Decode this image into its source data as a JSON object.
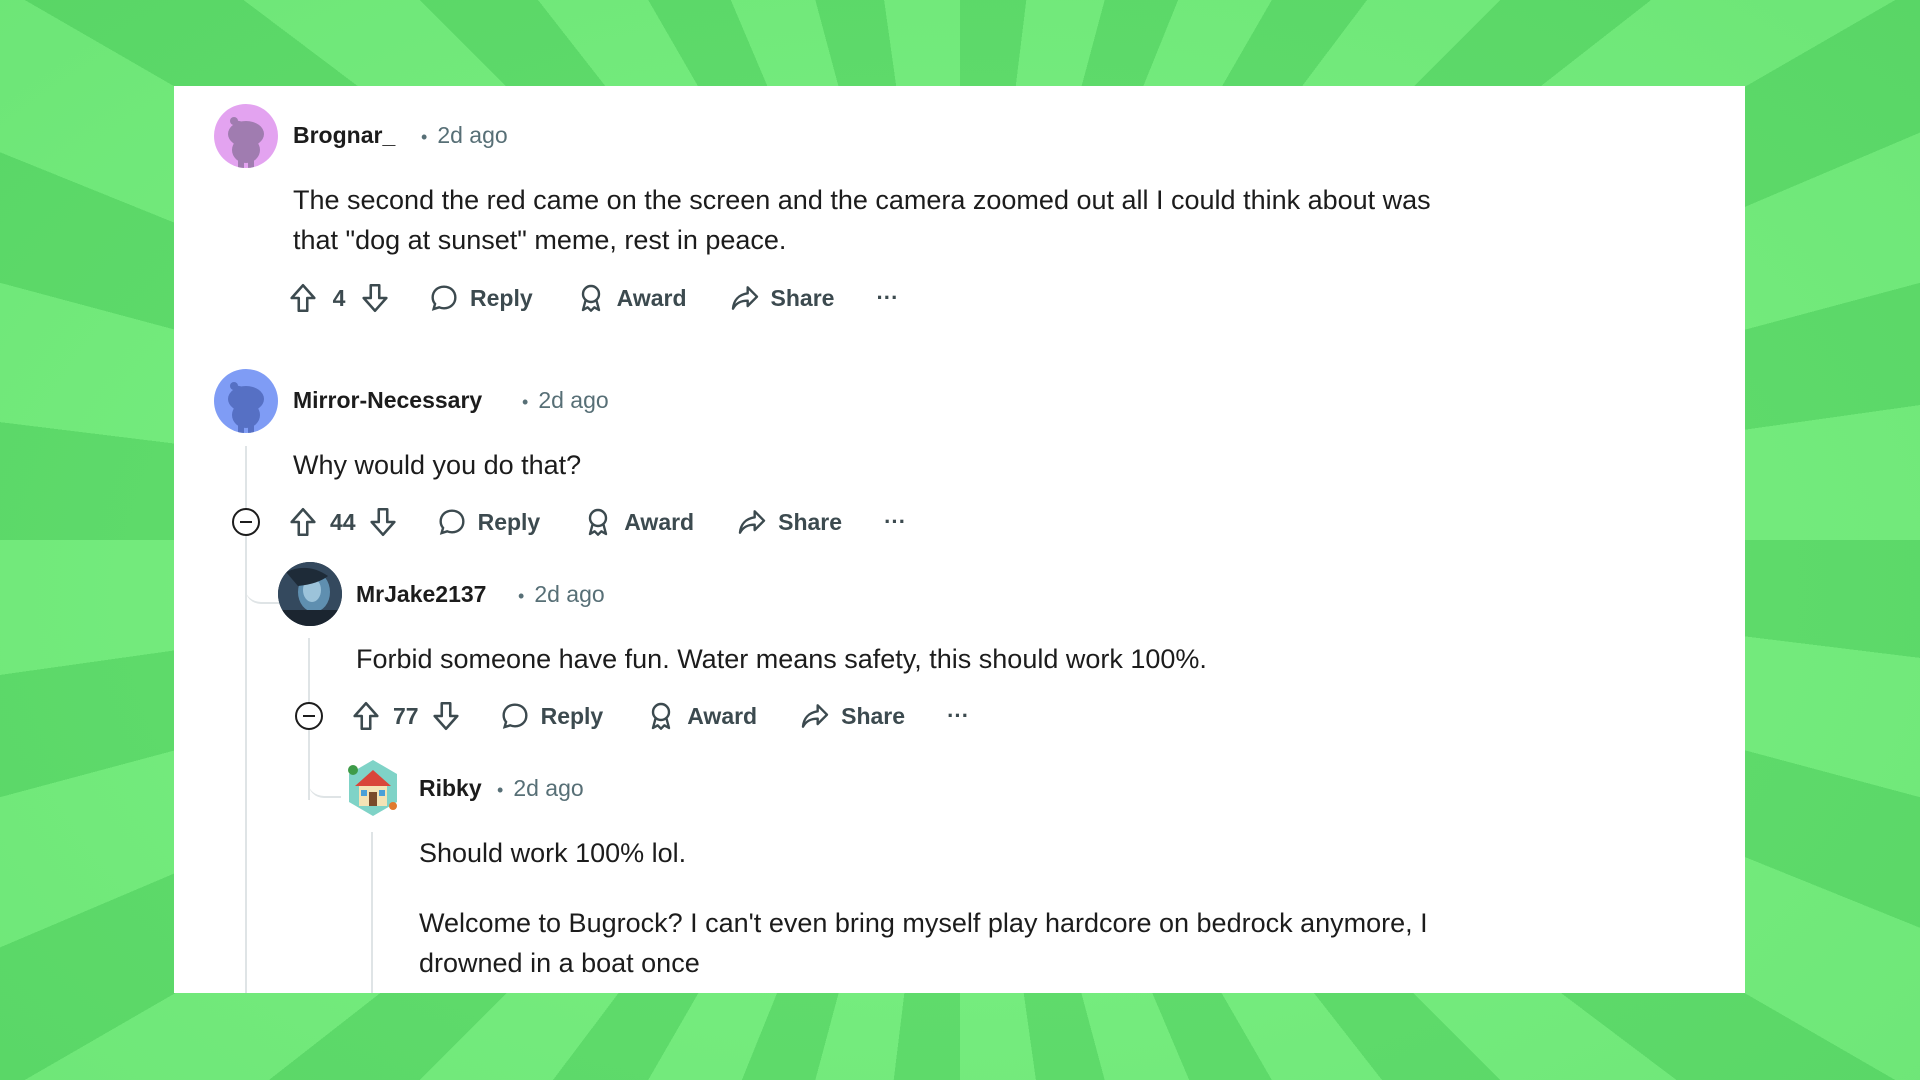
{
  "comments": [
    {
      "username": "Brognar_",
      "time": "2d ago",
      "text_lines": [
        "The second the red came on the screen and the camera zoomed out all I could think about was",
        "that \"dog at sunset\" meme, rest in peace."
      ],
      "votes": "4",
      "avatar_color": "#e3a3f0",
      "avatar_icon": "reddit-snoo-avatar"
    },
    {
      "username": "Mirror-Necessary",
      "time": "2d ago",
      "text_lines": [
        "Why would you do that?"
      ],
      "votes": "44",
      "avatar_color": "#7f9cf5",
      "avatar_icon": "reddit-snoo-avatar"
    },
    {
      "username": "MrJake2137",
      "time": "2d ago",
      "text_lines": [
        "Forbid someone have fun. Water means safety, this should work 100%."
      ],
      "votes": "77",
      "avatar_icon": "photo-avatar"
    },
    {
      "username": "Ribky",
      "time": "2d ago",
      "text_lines": [
        "Should work 100% lol.",
        "Welcome to Bugrock? I can't even bring myself play hardcore on bedrock anymore, I",
        "drowned in a boat once"
      ],
      "avatar_icon": "pixel-house-avatar"
    }
  ],
  "actions": {
    "reply": "Reply",
    "award": "Award",
    "share": "Share",
    "more": "···"
  },
  "colors": {
    "text": "#1c1c1c",
    "meta": "#576f76",
    "thread_line": "#dfe4e6",
    "background_green": "#6ee67a"
  }
}
